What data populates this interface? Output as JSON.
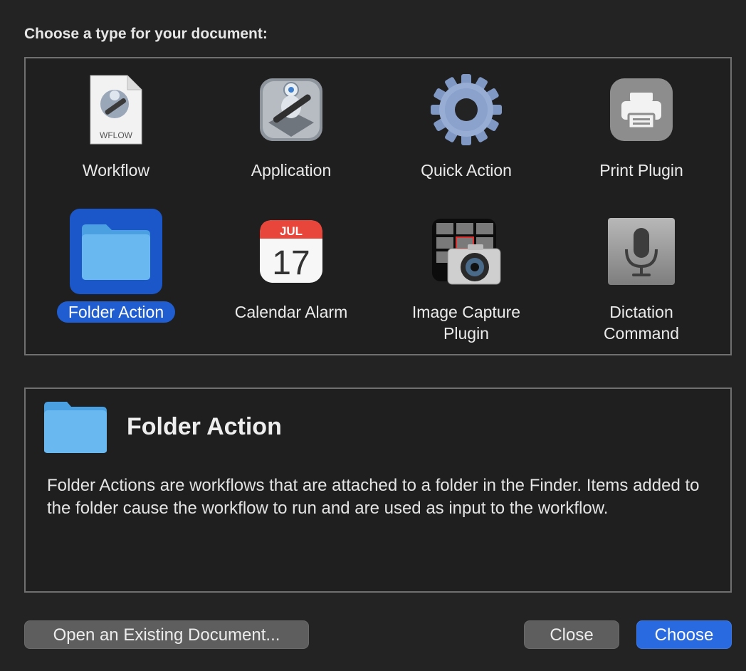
{
  "prompt": "Choose a type for your document:",
  "types": [
    {
      "label": "Workflow",
      "icon": "wflow-document-icon",
      "badge": "WFLOW"
    },
    {
      "label": "Application",
      "icon": "automator-robot-icon"
    },
    {
      "label": "Quick Action",
      "icon": "gear-icon"
    },
    {
      "label": "Print Plugin",
      "icon": "printer-icon"
    },
    {
      "label": "Folder Action",
      "icon": "folder-icon",
      "selected": true
    },
    {
      "label": "Calendar Alarm",
      "icon": "calendar-icon",
      "month": "JUL",
      "day": "17"
    },
    {
      "label": "Image Capture Plugin",
      "icon": "camera-icon"
    },
    {
      "label": "Dictation Command",
      "icon": "microphone-icon"
    }
  ],
  "detail": {
    "title": "Folder Action",
    "description": "Folder Actions are workflows that are attached to a folder in the Finder. Items added to the folder cause the workflow to run and are used as input to the workflow."
  },
  "buttons": {
    "open_existing": "Open an Existing Document...",
    "close": "Close",
    "choose": "Choose"
  },
  "colors": {
    "accent": "#1f5dd0",
    "folder": "#6ab8f0",
    "background": "#232323"
  }
}
